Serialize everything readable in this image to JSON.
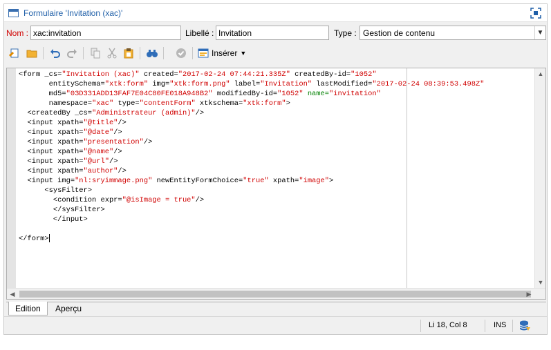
{
  "window": {
    "title": "Formulaire 'Invitation (xac)'"
  },
  "fields": {
    "nom_label": "Nom :",
    "nom_value": "xac:invitation",
    "libelle_label": "Libellé :",
    "libelle_value": "Invitation",
    "type_label": "Type :",
    "type_value": "Gestion de contenu"
  },
  "toolbar": {
    "insert_label": "Insérer",
    "icons": [
      "new-icon",
      "open-folder-icon",
      "undo-icon",
      "redo-icon",
      "copy-icon",
      "cut-icon",
      "paste-icon",
      "find-icon",
      "validate-icon",
      "insert-icon"
    ]
  },
  "editor": {
    "lines": [
      [
        [
          "<form _cs=",
          "t"
        ],
        [
          "\"Invitation (xac)\"",
          "v"
        ],
        [
          " created=",
          "t"
        ],
        [
          "\"2017-02-24 07:44:21.335Z\"",
          "v"
        ],
        [
          " createdBy-id=",
          "t"
        ],
        [
          "\"1052\"",
          "v"
        ]
      ],
      [
        [
          "       entitySchema=",
          "t"
        ],
        [
          "\"xtk:form\"",
          "v"
        ],
        [
          " img=",
          "t"
        ],
        [
          "\"xtk:form.png\"",
          "v"
        ],
        [
          " label=",
          "t"
        ],
        [
          "\"Invitation\"",
          "v"
        ],
        [
          " lastModified=",
          "t"
        ],
        [
          "\"2017-02-24 08:39:53.498Z\"",
          "v"
        ]
      ],
      [
        [
          "       md5=",
          "t"
        ],
        [
          "\"03D331ADD13FAF7E04C80FE018A948B2\"",
          "v"
        ],
        [
          " modifiedBy-id=",
          "t"
        ],
        [
          "\"1052\"",
          "v"
        ],
        [
          " ",
          "t"
        ],
        [
          "name=",
          "n"
        ],
        [
          "\"invitation\"",
          "v"
        ]
      ],
      [
        [
          "       namespace=",
          "t"
        ],
        [
          "\"xac\"",
          "v"
        ],
        [
          " type=",
          "t"
        ],
        [
          "\"contentForm\"",
          "v"
        ],
        [
          " xtkschema=",
          "t"
        ],
        [
          "\"xtk:form\"",
          "v"
        ],
        [
          ">",
          "t"
        ]
      ],
      [
        [
          "  <createdBy _cs=",
          "t"
        ],
        [
          "\"Administrateur (admin)\"",
          "v"
        ],
        [
          "/>",
          "t"
        ]
      ],
      [
        [
          "  <input xpath=",
          "t"
        ],
        [
          "\"@title\"",
          "v"
        ],
        [
          "/>",
          "t"
        ]
      ],
      [
        [
          "  <input xpath=",
          "t"
        ],
        [
          "\"@date\"",
          "v"
        ],
        [
          "/>",
          "t"
        ]
      ],
      [
        [
          "  <input xpath=",
          "t"
        ],
        [
          "\"presentation\"",
          "v"
        ],
        [
          "/>",
          "t"
        ]
      ],
      [
        [
          "  <input xpath=",
          "t"
        ],
        [
          "\"@name\"",
          "v"
        ],
        [
          "/>",
          "t"
        ]
      ],
      [
        [
          "  <input xpath=",
          "t"
        ],
        [
          "\"@url\"",
          "v"
        ],
        [
          "/>",
          "t"
        ]
      ],
      [
        [
          "  <input xpath=",
          "t"
        ],
        [
          "\"author\"",
          "v"
        ],
        [
          "/>",
          "t"
        ]
      ],
      [
        [
          "  <input img=",
          "t"
        ],
        [
          "\"nl:sryimmage.png\"",
          "v"
        ],
        [
          " newEntityFormChoice=",
          "t"
        ],
        [
          "\"true\"",
          "v"
        ],
        [
          " xpath=",
          "t"
        ],
        [
          "\"image\"",
          "v"
        ],
        [
          ">",
          "t"
        ]
      ],
      [
        [
          "      <sysFilter>",
          "t"
        ]
      ],
      [
        [
          "        <condition expr=",
          "t"
        ],
        [
          "\"@isImage = true\"",
          "v"
        ],
        [
          "/>",
          "t"
        ]
      ],
      [
        [
          "        </sysFilter>",
          "t"
        ]
      ],
      [
        [
          "        </input>",
          "t"
        ]
      ],
      [
        [
          "",
          "t"
        ]
      ],
      [
        [
          "</form>",
          "t"
        ]
      ]
    ]
  },
  "tabs": [
    {
      "label": "Edition",
      "active": true
    },
    {
      "label": "Aperçu",
      "active": false
    }
  ],
  "status": {
    "position": "Li 18, Col 8",
    "mode": "INS"
  }
}
